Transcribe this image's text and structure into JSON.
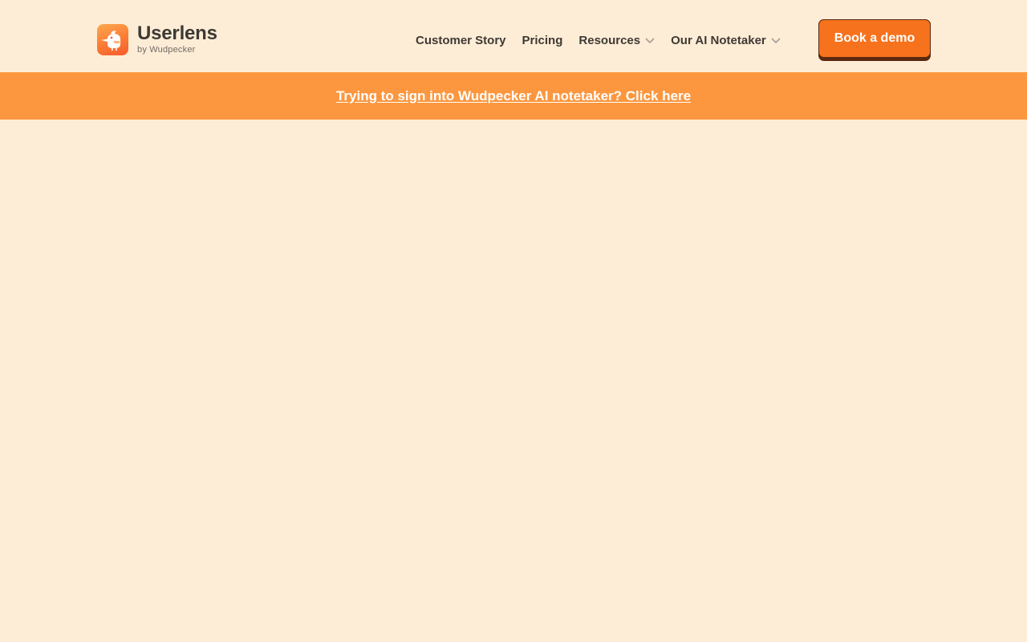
{
  "brand": {
    "name": "Userlens",
    "tagline": "by Wudpecker",
    "logo_icon": "woodpecker-logo-icon",
    "colors": {
      "gradient_top": "#FDA84E",
      "gradient_bottom": "#F65B2B"
    }
  },
  "nav": {
    "items": [
      {
        "label": "Customer Story",
        "has_dropdown": false
      },
      {
        "label": "Pricing",
        "has_dropdown": false
      },
      {
        "label": "Resources",
        "has_dropdown": true,
        "icon": "chevron-down-icon"
      },
      {
        "label": "Our AI Notetaker",
        "has_dropdown": true,
        "icon": "chevron-down-icon"
      }
    ]
  },
  "cta": {
    "label": "Book a demo",
    "color": "#F7721D",
    "shadow_color": "#5A2A10"
  },
  "banner": {
    "text": "Trying to sign into Wudpecker AI notetaker? Click here",
    "background": "#FC973F"
  },
  "theme": {
    "page_background": "#FEEDD6",
    "text_color": "#3E3935"
  }
}
